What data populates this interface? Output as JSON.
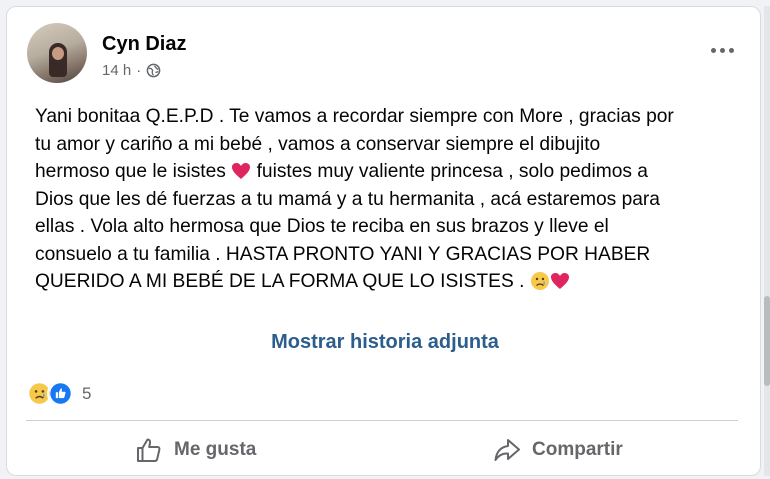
{
  "post": {
    "author": "Cyn Diaz",
    "time": "14 h",
    "separator": "·",
    "text_line1": "Yani bonitaa Q.E.P.D . Te vamos a recordar siempre con More , gracias por",
    "text_line2": "tu amor y cariño a mi bebé , vamos a conservar siempre el dibujito",
    "text_line3a": "hermoso que le isistes ",
    "text_line3b": " fuistes muy valiente princesa , solo pedimos a",
    "text_line4": "Dios que les dé fuerzas a tu mamá y a tu hermanita , acá estaremos para",
    "text_line5": "ellas . Vola alto hermosa que Dios te reciba en sus brazos y lleve el",
    "text_line6": "consuelo a tu familia . HASTA PRONTO YANI Y GRACIAS POR HABER",
    "text_line7": "QUERIDO A MI BEBÉ DE LA FORMA QUE LO ISISTES . ",
    "story_link": "Mostrar historia adjunta"
  },
  "reactions": {
    "icons": [
      "sad-reaction-icon",
      "like-reaction-icon"
    ],
    "count": "5"
  },
  "actions": {
    "like_label": "Me gusta",
    "share_label": "Compartir"
  },
  "colors": {
    "link": "#2b5e8c",
    "heart": "#e0245e",
    "like_blue": "#1877f2",
    "muted": "#65676b"
  }
}
